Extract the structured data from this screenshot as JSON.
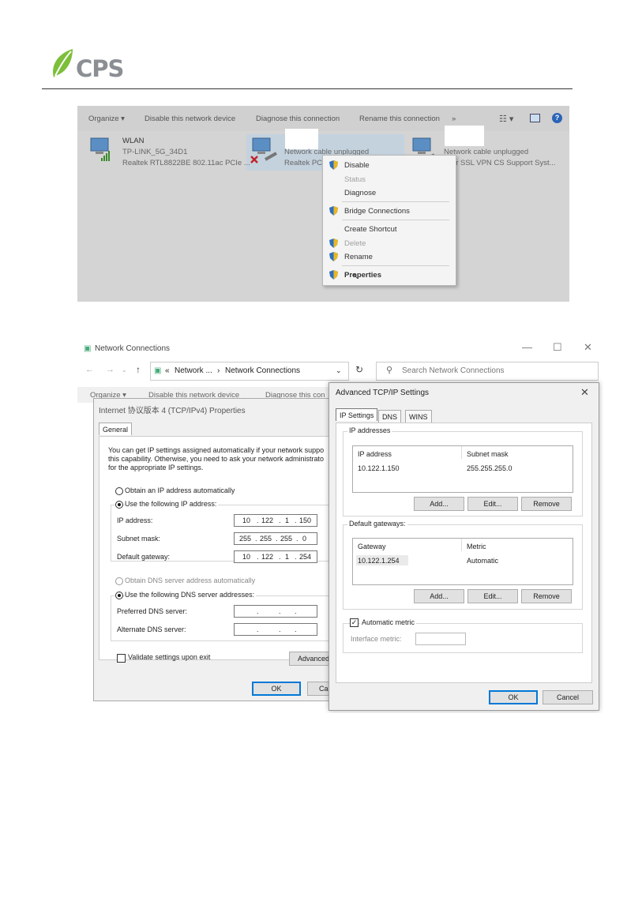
{
  "header": {
    "logo_text": "CPS",
    "brand_color": "#7cbf3a"
  },
  "shot1": {
    "toolbar": [
      "Organize ▾",
      "Disable this network device",
      "Diagnose this connection",
      "Rename this connection",
      "»"
    ],
    "adapters": [
      {
        "name": "WLAN",
        "line2": "TP-LINK_5G_34D1",
        "line3": "Realtek RTL8822BE 802.11ac PCIe ..."
      },
      {
        "name": "",
        "line2": "Network cable unplugged",
        "line3": "Realtek PCIe"
      },
      {
        "name": "",
        "line2": "Network cable unplugged",
        "line3": "gfor SSL VPN CS Support Syst..."
      }
    ],
    "context_menu": {
      "disable": "Disable",
      "status": "Status",
      "diagnose": "Diagnose",
      "bridge": "Bridge Connections",
      "shortcut": "Create Shortcut",
      "delete": "Delete",
      "rename": "Rename",
      "properties": "Properties"
    }
  },
  "shot2": {
    "window_title": "Network Connections",
    "address_parts": [
      "«",
      "Network ...",
      "›",
      "Network Connections"
    ],
    "search_placeholder": "Search Network Connections",
    "toolbar_partial": [
      "Organize ▾",
      "Disable this network device",
      "Diagnose this con"
    ],
    "ipv4_dialog": {
      "title": "Internet 协议版本 4 (TCP/IPv4) Properties",
      "tab": "General",
      "description": [
        "You can get IP settings assigned automatically if your network suppo",
        "this capability. Otherwise, you need to ask your network administrato",
        "for the appropriate IP settings."
      ],
      "auto_ip": "Obtain an IP address automatically",
      "use_ip": "Use the following IP address:",
      "ip_label": "IP address:",
      "ip_value": [
        "10",
        "122",
        "1",
        "150"
      ],
      "mask_label": "Subnet mask:",
      "mask_value": [
        "255",
        "255",
        "255",
        "0"
      ],
      "gw_label": "Default gateway:",
      "gw_value": [
        "10",
        "122",
        "1",
        "254"
      ],
      "auto_dns": "Obtain DNS server address automatically",
      "use_dns": "Use the following DNS server addresses:",
      "pref_dns": "Preferred DNS server:",
      "alt_dns": "Alternate DNS server:",
      "validate": "Validate settings upon exit",
      "advanced": "Advanced",
      "ok": "OK",
      "cancel": "Ca"
    },
    "advanced_dialog": {
      "title": "Advanced TCP/IP Settings",
      "tabs": [
        "IP Settings",
        "DNS",
        "WINS"
      ],
      "ip_group": "IP addresses",
      "ip_cols": [
        "IP address",
        "Subnet mask"
      ],
      "ip_row": [
        "10.122.1.150",
        "255.255.255.0"
      ],
      "gw_group": "Default gateways:",
      "gw_cols": [
        "Gateway",
        "Metric"
      ],
      "gw_row": [
        "10.122.1.254",
        "Automatic"
      ],
      "add": "Add...",
      "edit": "Edit...",
      "remove": "Remove",
      "auto_metric": "Automatic metric",
      "iface_metric": "Interface metric:",
      "ok": "OK",
      "cancel": "Cancel"
    }
  }
}
